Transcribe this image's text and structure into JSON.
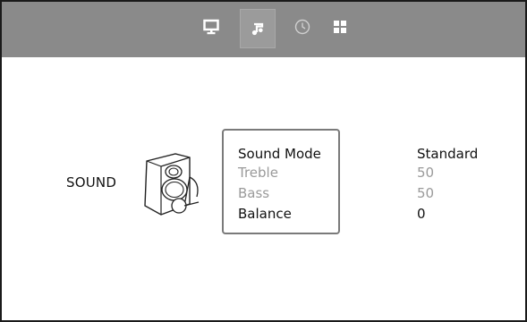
{
  "tabs": [
    {
      "icon": "monitor-icon",
      "selected": false
    },
    {
      "icon": "music-note-icon",
      "selected": true
    },
    {
      "icon": "clock-icon",
      "selected": false
    },
    {
      "icon": "grid-icon",
      "selected": false
    }
  ],
  "section": {
    "label": "SOUND",
    "icon": "speaker-icon"
  },
  "settings": [
    {
      "label": "Sound Mode",
      "value": "Standard",
      "state": "selected"
    },
    {
      "label": "Treble",
      "value": "50",
      "state": "disabled"
    },
    {
      "label": "Bass",
      "value": "50",
      "state": "disabled"
    },
    {
      "label": "Balance",
      "value": "0",
      "state": "enabled"
    }
  ],
  "colors": {
    "topbar": "#8a8a8a",
    "selected_tab": "#9b9b9b",
    "text": "#111111",
    "dim_text": "#9a9a9a",
    "icon": "#ffffff"
  }
}
